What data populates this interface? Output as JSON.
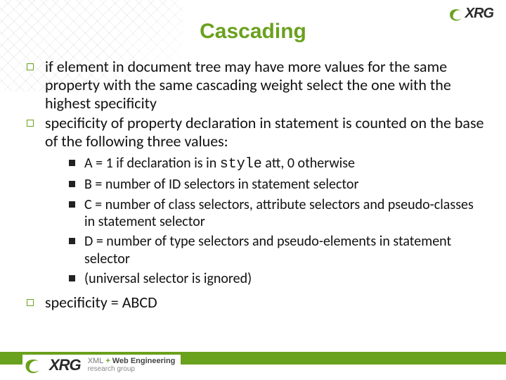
{
  "accent_color": "#6aa11d",
  "logo": {
    "brand": "XRG",
    "tagline_top_pre": "XML",
    "tagline_top_post": "Web Engineering",
    "tagline_bottom": "research group"
  },
  "title": "Cascading",
  "bullets": {
    "b1": "if element in document tree may have more values for the same property with the same cascading weight select the one with the highest specificity",
    "b2": "specificity of property declaration in statement is counted on the base of the following three values:",
    "sub": {
      "a_pre": "A = 1 if declaration is in ",
      "a_code": "style",
      "a_post": " att, 0 otherwise",
      "b": "B = number of ID selectors in statement selector",
      "c": "C = number of class selectors, attribute selectors and pseudo-classes in statement selector",
      "d": "D = number of type selectors and pseudo-elements in statement selector",
      "e": "(universal selector is ignored)"
    },
    "b3": "specificity = ABCD"
  }
}
